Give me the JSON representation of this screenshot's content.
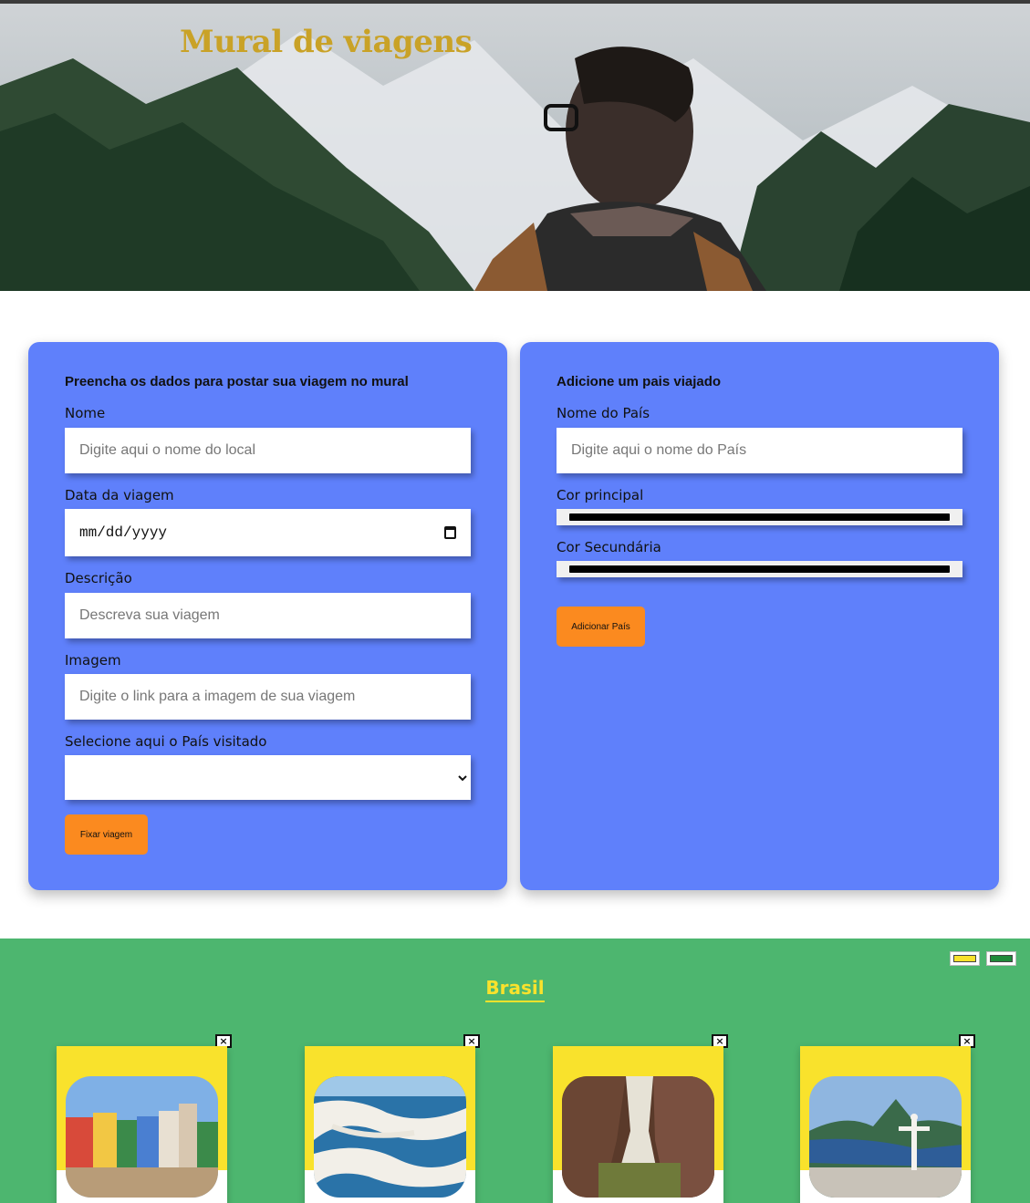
{
  "header": {
    "title": "Mural de viagens"
  },
  "trip_form": {
    "heading": "Preencha os dados para postar sua viagem no mural",
    "name_label": "Nome",
    "name_placeholder": "Digite aqui o nome do local",
    "date_label": "Data da viagem",
    "date_value": "mm/dd/yyyy",
    "description_label": "Descrição",
    "description_placeholder": "Descreva sua viagem",
    "image_label": "Imagem",
    "image_placeholder": "Digite o link para a imagem de sua viagem",
    "country_label": "Selecione aqui o País visitado",
    "country_value": "",
    "submit_label": "Fixar viagem"
  },
  "country_form": {
    "heading": "Adicione um pais viajado",
    "name_label": "Nome do País",
    "name_placeholder": "Digite aqui o nome do País",
    "primary_color_label": "Cor principal",
    "primary_color_value": "#000000",
    "secondary_color_label": "Cor Secundária",
    "secondary_color_value": "#000000",
    "submit_label": "Adicionar País"
  },
  "country_section": {
    "name": "Brasil",
    "primary_color": "#4db66f",
    "secondary_color": "#f9e22c",
    "color_buttons": [
      {
        "icon": "yellow-swatch",
        "color": "#f9e22c"
      },
      {
        "icon": "green-swatch",
        "color": "#1f8a3a"
      }
    ],
    "close_symbol": "×",
    "cards": [
      {
        "image": "colonial-street-photo"
      },
      {
        "image": "sand-dunes-lagoons-photo"
      },
      {
        "image": "canyon-river-photo"
      },
      {
        "image": "christ-redeemer-bay-photo"
      }
    ]
  },
  "colors": {
    "panel": "#5f80fb",
    "button": "#fb8a1f",
    "title": "#c9a227"
  }
}
